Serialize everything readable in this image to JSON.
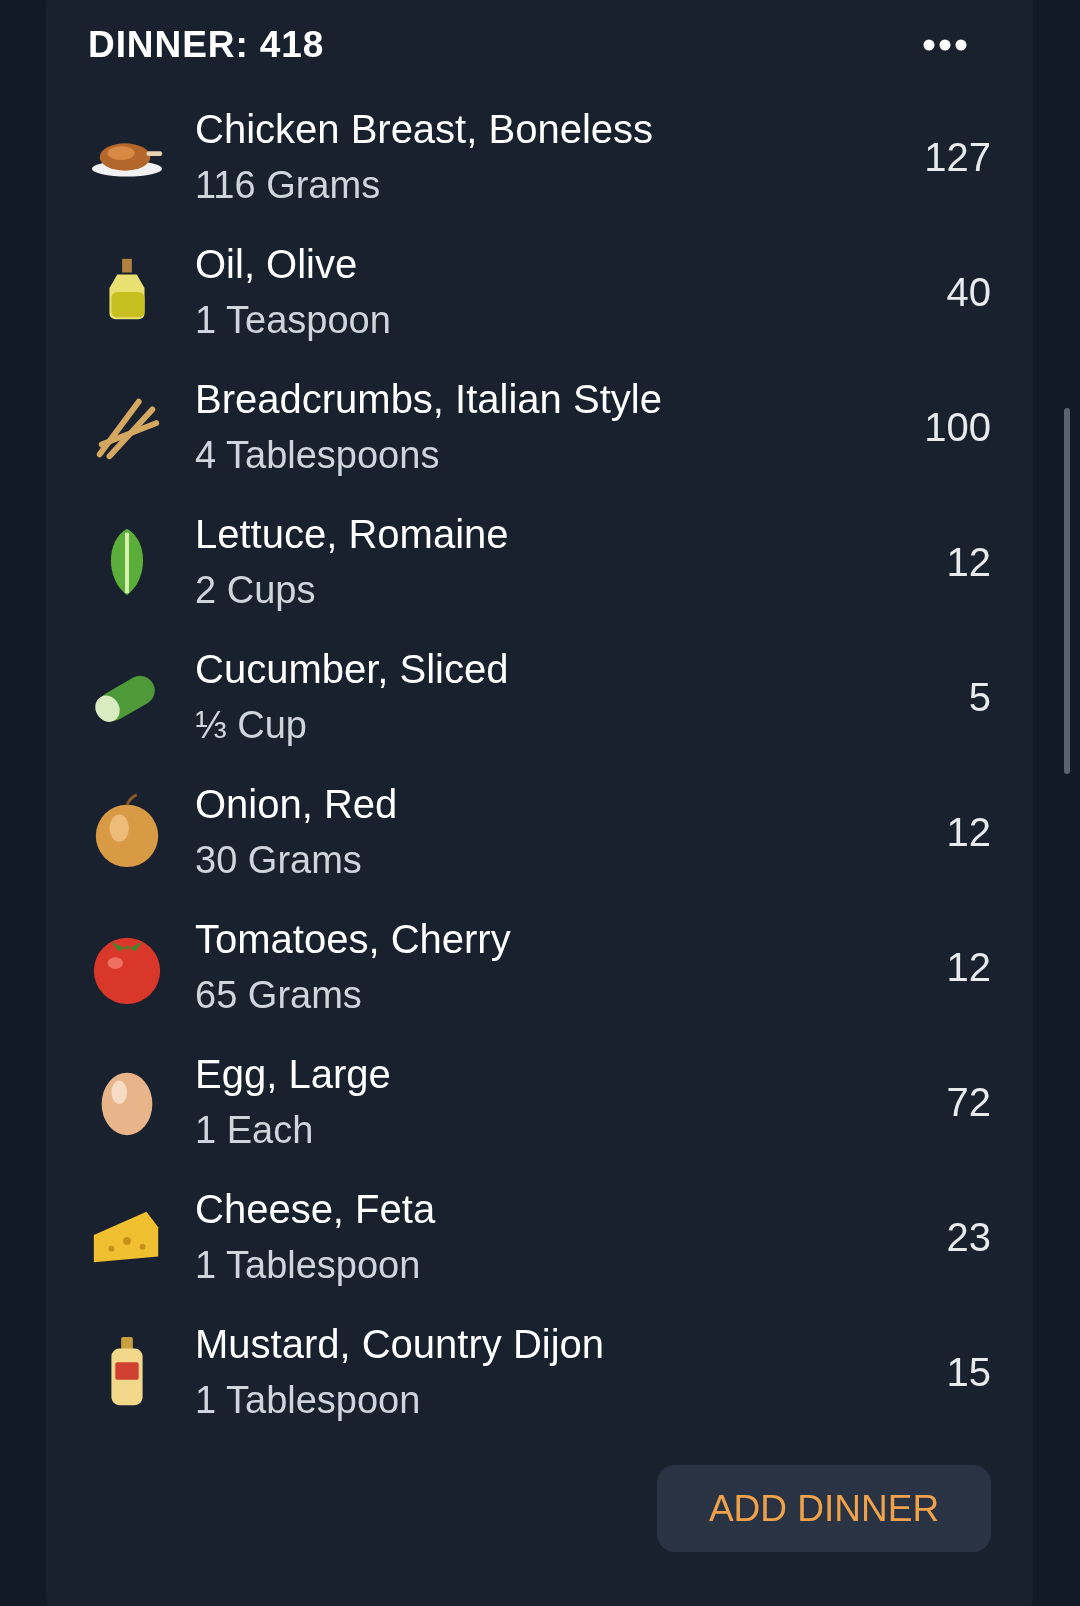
{
  "meal": {
    "title": "DINNER: 418",
    "items": [
      {
        "name": "Chicken Breast, Boneless",
        "amount": "116 Grams",
        "calories": "127"
      },
      {
        "name": "Oil, Olive",
        "amount": "1 Teaspoon",
        "calories": "40"
      },
      {
        "name": "Breadcrumbs, Italian Style",
        "amount": "4 Tablespoons",
        "calories": "100"
      },
      {
        "name": "Lettuce, Romaine",
        "amount": "2 Cups",
        "calories": "12"
      },
      {
        "name": "Cucumber, Sliced",
        "amount": "⅓ Cup",
        "calories": "5"
      },
      {
        "name": "Onion, Red",
        "amount": "30 Grams",
        "calories": "12"
      },
      {
        "name": "Tomatoes, Cherry",
        "amount": "65 Grams",
        "calories": "12"
      },
      {
        "name": "Egg, Large",
        "amount": "1 Each",
        "calories": "72"
      },
      {
        "name": "Cheese, Feta",
        "amount": "1 Tablespoon",
        "calories": "23"
      },
      {
        "name": "Mustard, Country Dijon",
        "amount": "1 Tablespoon",
        "calories": "15"
      }
    ],
    "add_button": "ADD DINNER"
  }
}
